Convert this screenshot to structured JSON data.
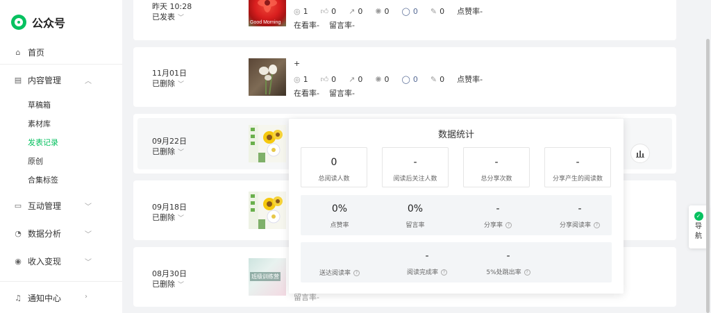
{
  "brand": {
    "name": "公众号"
  },
  "nav": {
    "home": "首页",
    "content": "内容管理",
    "sub": [
      "草稿箱",
      "素材库",
      "发表记录",
      "原创",
      "合集标签"
    ],
    "interaction": "互动管理",
    "analytics": "数据分析",
    "monetization": "收入变现",
    "notifications": "通知中心"
  },
  "posts": [
    {
      "date": "昨天 10:28",
      "status": "已发表",
      "views": "1",
      "likes": "0",
      "shares": "0",
      "wows": "0",
      "comments": "0",
      "edits": "0",
      "like_rate": "点赞率-",
      "looking_rate": "在看率-",
      "comment_rate": "留言率-"
    },
    {
      "date": "11月01日",
      "status": "已删除",
      "title": "+",
      "views": "1",
      "likes": "0",
      "shares": "0",
      "wows": "0",
      "comments": "0",
      "edits": "0",
      "like_rate": "点赞率-",
      "looking_rate": "在看率-",
      "comment_rate": "留言率-"
    },
    {
      "date": "09月22日",
      "status": "已删除"
    },
    {
      "date": "09月18日",
      "status": "已删除"
    },
    {
      "date": "08月30日",
      "status": "已删除",
      "thumb_text": "班级训练营",
      "partial": "留言率-"
    }
  ],
  "stats_popup": {
    "title": "数据统计",
    "row1": [
      {
        "value": "0",
        "label": "总阅读人数"
      },
      {
        "value": "-",
        "label": "阅读后关注人数"
      },
      {
        "value": "-",
        "label": "总分享次数"
      },
      {
        "value": "-",
        "label": "分享产生的阅读数"
      }
    ],
    "row2": [
      {
        "value": "0%",
        "label": "点赞率"
      },
      {
        "value": "0%",
        "label": "留言率"
      },
      {
        "value": "-",
        "label": "分享率"
      },
      {
        "value": "-",
        "label": "分享阅读率"
      }
    ],
    "row3": [
      {
        "value": "",
        "label": "送达阅读率"
      },
      {
        "value": "-",
        "label": "阅读完成率"
      },
      {
        "value": "-",
        "label": "5%处跳出率"
      }
    ]
  },
  "guide": {
    "line1": "导",
    "line2": "航"
  },
  "colors": {
    "accent": "#07c160",
    "link": "#576b95"
  }
}
